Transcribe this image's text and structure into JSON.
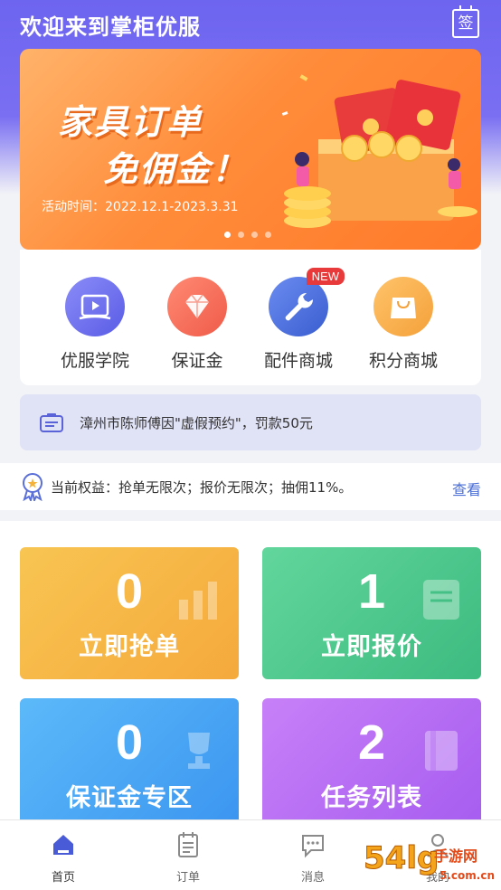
{
  "header": {
    "title": "欢迎来到掌柜优服",
    "sign_label": "签"
  },
  "banner": {
    "line1": "家具订单",
    "line2": "免佣金！",
    "date": "活动时间：2022.12.1-2023.3.31",
    "dots": 4,
    "active_dot": 0
  },
  "quick_actions": [
    {
      "label": "优服学院",
      "icon": "video-book-icon",
      "color": "#6b6cf0"
    },
    {
      "label": "保证金",
      "icon": "diamond-icon",
      "color": "#f46a55"
    },
    {
      "label": "配件商城",
      "icon": "wrench-icon",
      "color": "#4a6ed6",
      "badge": "NEW"
    },
    {
      "label": "积分商城",
      "icon": "shopping-bag-icon",
      "color": "#f6a93b"
    }
  ],
  "notice": {
    "text": "漳州市陈师傅因\"虚假预约\"，罚款50元"
  },
  "benefit": {
    "text": "当前权益：抢单无限次；报价无限次；抽佣11%。",
    "link": "查看"
  },
  "tiles": [
    {
      "count": "0",
      "label": "立即抢单",
      "color_from": "#f8c24e",
      "color_to": "#f5a73b",
      "icon": "bar-chart-icon"
    },
    {
      "count": "1",
      "label": "立即报价",
      "color_from": "#5fd49a",
      "color_to": "#3dbb80",
      "icon": "document-icon"
    },
    {
      "count": "0",
      "label": "保证金专区",
      "color_from": "#5ab6f8",
      "color_to": "#3a93f0",
      "icon": "trophy-icon"
    },
    {
      "count": "2",
      "label": "任务列表",
      "color_from": "#c67ef7",
      "color_to": "#a55bef",
      "icon": "book-icon"
    }
  ],
  "tabbar": [
    {
      "label": "首页",
      "icon": "home-icon",
      "active": true
    },
    {
      "label": "订单",
      "icon": "clipboard-icon",
      "active": false
    },
    {
      "label": "消息",
      "icon": "message-icon",
      "active": false
    },
    {
      "label": "我的",
      "icon": "user-icon",
      "active": false
    }
  ],
  "watermark": {
    "text": "54lg手游网",
    "url": "5.com.cn"
  }
}
